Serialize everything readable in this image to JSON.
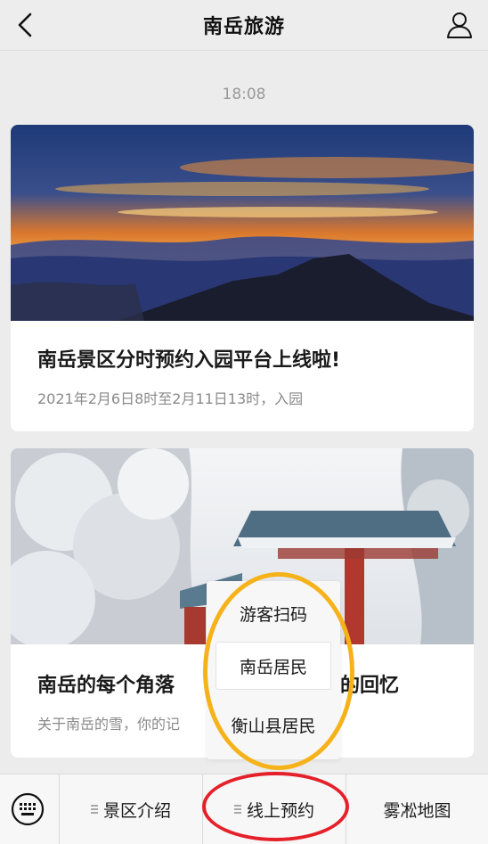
{
  "header": {
    "title": "南岳旅游",
    "back_icon": "chevron-left-icon",
    "profile_icon": "user-icon"
  },
  "timestamp": "18:08",
  "articles": [
    {
      "title": "南岳景区分时预约入园平台上线啦!",
      "description": "2021年2月6日8时至2月11日13时，入园"
    },
    {
      "title_left": "南岳的每个角落",
      "title_right": "的回忆",
      "description": "关于南岳的雪，你的记"
    }
  ],
  "submenu": {
    "items": [
      "游客扫码",
      "南岳居民",
      "衡山县居民"
    ]
  },
  "tabbar": {
    "keyboard_icon": "keyboard-icon",
    "tabs": [
      "景区介绍",
      "线上预约",
      "雾凇地图"
    ]
  },
  "annotation_colors": {
    "popup_highlight": "#f6b21a",
    "tab_highlight": "#e5202a"
  }
}
